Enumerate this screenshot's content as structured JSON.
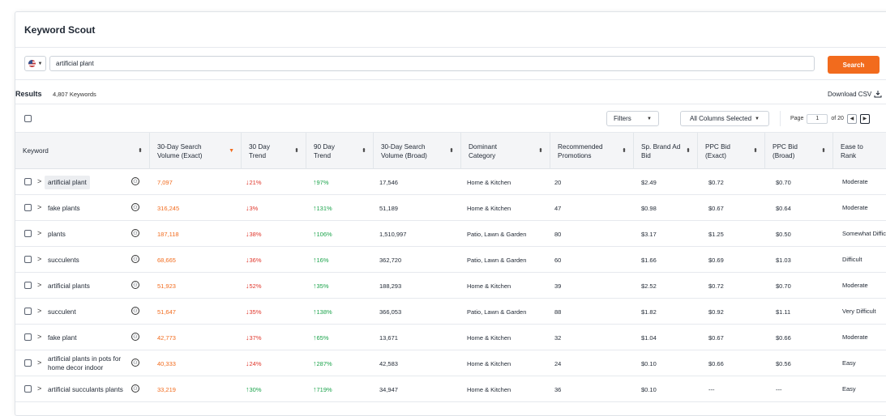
{
  "app": {
    "title": "Keyword Scout"
  },
  "search": {
    "value": "artificial plant",
    "button": "Search"
  },
  "results": {
    "label": "Results",
    "count": "4,807 Keywords",
    "download": "Download CSV"
  },
  "toolbar": {
    "filters": "Filters",
    "columns": "All Columns Selected",
    "page_label": "Page",
    "page_value": "1",
    "page_total": "of 20"
  },
  "columns": [
    "Keyword",
    "30-Day Search Volume (Exact)",
    "30 Day Trend",
    "90 Day Trend",
    "30-Day Search Volume (Broad)",
    "Dominant Category",
    "Recommended Promotions",
    "Sp. Brand Ad Bid",
    "PPC Bid (Exact)",
    "PPC Bid (Broad)",
    "Ease to Rank"
  ],
  "rows": [
    {
      "keyword": "artificial plant",
      "exact": "7,097",
      "t30": "21%",
      "t30_dir": "down",
      "t90": "97%",
      "t90_dir": "up",
      "broad": "17,546",
      "category": "Home & Kitchen",
      "promos": "20",
      "sp": "$2.49",
      "ppc_exact": "$0.72",
      "ppc_broad": "$0.70",
      "ease": "Moderate"
    },
    {
      "keyword": "fake plants",
      "exact": "316,245",
      "t30": "3%",
      "t30_dir": "down",
      "t90": "131%",
      "t90_dir": "up",
      "broad": "51,189",
      "category": "Home & Kitchen",
      "promos": "47",
      "sp": "$0.98",
      "ppc_exact": "$0.67",
      "ppc_broad": "$0.64",
      "ease": "Moderate"
    },
    {
      "keyword": "plants",
      "exact": "187,118",
      "t30": "38%",
      "t30_dir": "down",
      "t90": "106%",
      "t90_dir": "up",
      "broad": "1,510,997",
      "category": "Patio, Lawn & Garden",
      "promos": "80",
      "sp": "$3.17",
      "ppc_exact": "$1.25",
      "ppc_broad": "$0.50",
      "ease": "Somewhat Difficult"
    },
    {
      "keyword": "succulents",
      "exact": "68,665",
      "t30": "36%",
      "t30_dir": "down",
      "t90": "16%",
      "t90_dir": "up",
      "broad": "362,720",
      "category": "Patio, Lawn & Garden",
      "promos": "60",
      "sp": "$1.66",
      "ppc_exact": "$0.69",
      "ppc_broad": "$1.03",
      "ease": "Difficult"
    },
    {
      "keyword": "artificial plants",
      "exact": "51,923",
      "t30": "52%",
      "t30_dir": "down",
      "t90": "35%",
      "t90_dir": "up",
      "broad": "188,293",
      "category": "Home & Kitchen",
      "promos": "39",
      "sp": "$2.52",
      "ppc_exact": "$0.72",
      "ppc_broad": "$0.70",
      "ease": "Moderate"
    },
    {
      "keyword": "succulent",
      "exact": "51,647",
      "t30": "35%",
      "t30_dir": "down",
      "t90": "138%",
      "t90_dir": "up",
      "broad": "366,053",
      "category": "Patio, Lawn & Garden",
      "promos": "88",
      "sp": "$1.82",
      "ppc_exact": "$0.92",
      "ppc_broad": "$1.11",
      "ease": "Very Difficult"
    },
    {
      "keyword": "fake plant",
      "exact": "42,773",
      "t30": "37%",
      "t30_dir": "down",
      "t90": "65%",
      "t90_dir": "up",
      "broad": "13,671",
      "category": "Home & Kitchen",
      "promos": "32",
      "sp": "$1.04",
      "ppc_exact": "$0.67",
      "ppc_broad": "$0.66",
      "ease": "Moderate"
    },
    {
      "keyword": "artificial plants in pots for home decor indoor",
      "exact": "40,333",
      "t30": "24%",
      "t30_dir": "down",
      "t90": "287%",
      "t90_dir": "up",
      "broad": "42,583",
      "category": "Home & Kitchen",
      "promos": "24",
      "sp": "$0.10",
      "ppc_exact": "$0.66",
      "ppc_broad": "$0.56",
      "ease": "Easy"
    },
    {
      "keyword": "artificial succulants plants",
      "exact": "33,219",
      "t30": "30%",
      "t30_dir": "up",
      "t90": "719%",
      "t90_dir": "up",
      "broad": "34,947",
      "category": "Home & Kitchen",
      "promos": "36",
      "sp": "$0.10",
      "ppc_exact": "---",
      "ppc_broad": "---",
      "ease": "Easy"
    }
  ]
}
